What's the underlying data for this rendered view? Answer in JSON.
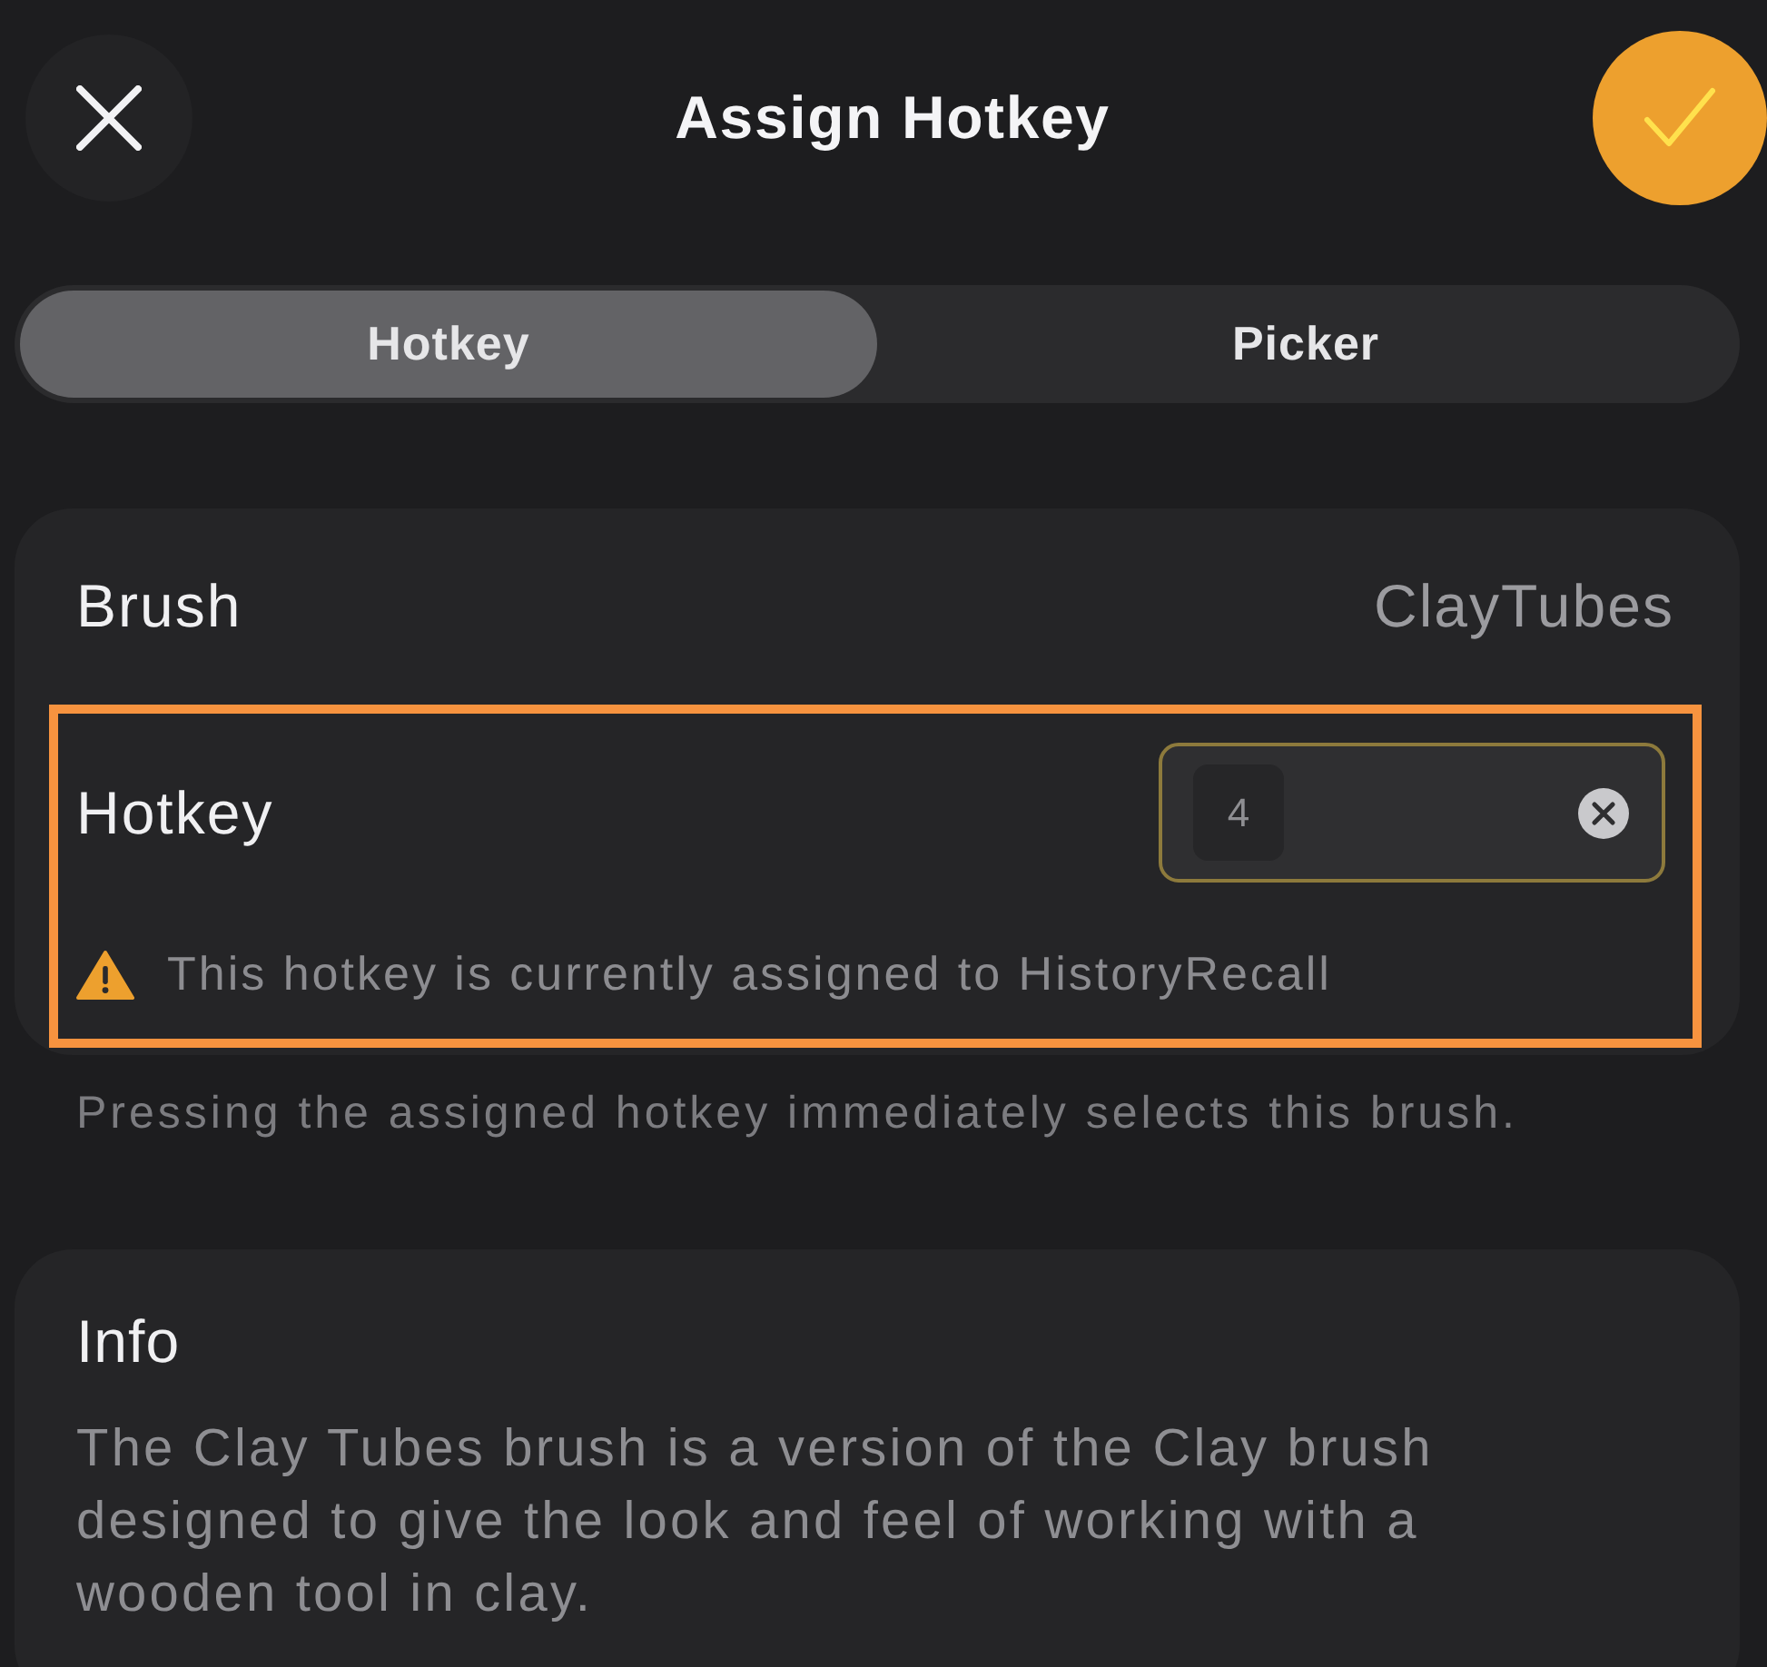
{
  "header": {
    "title": "Assign Hotkey"
  },
  "tabs": [
    {
      "label": "Hotkey",
      "selected": true
    },
    {
      "label": "Picker",
      "selected": false
    }
  ],
  "settings": {
    "rows": [
      {
        "kind": "value",
        "label": "Brush",
        "value": "ClayTubes"
      },
      {
        "kind": "hotkey",
        "label": "Hotkey",
        "value": "4",
        "highlighted": true,
        "warning": "This hotkey is currently assigned to HistoryRecall"
      }
    ],
    "footnote": "Pressing the assigned hotkey immediately selects this brush."
  },
  "info": {
    "title": "Info",
    "text": "The Clay Tubes brush is a version of the Clay brush designed to give the look and feel of working with a wooden tool in clay."
  }
}
